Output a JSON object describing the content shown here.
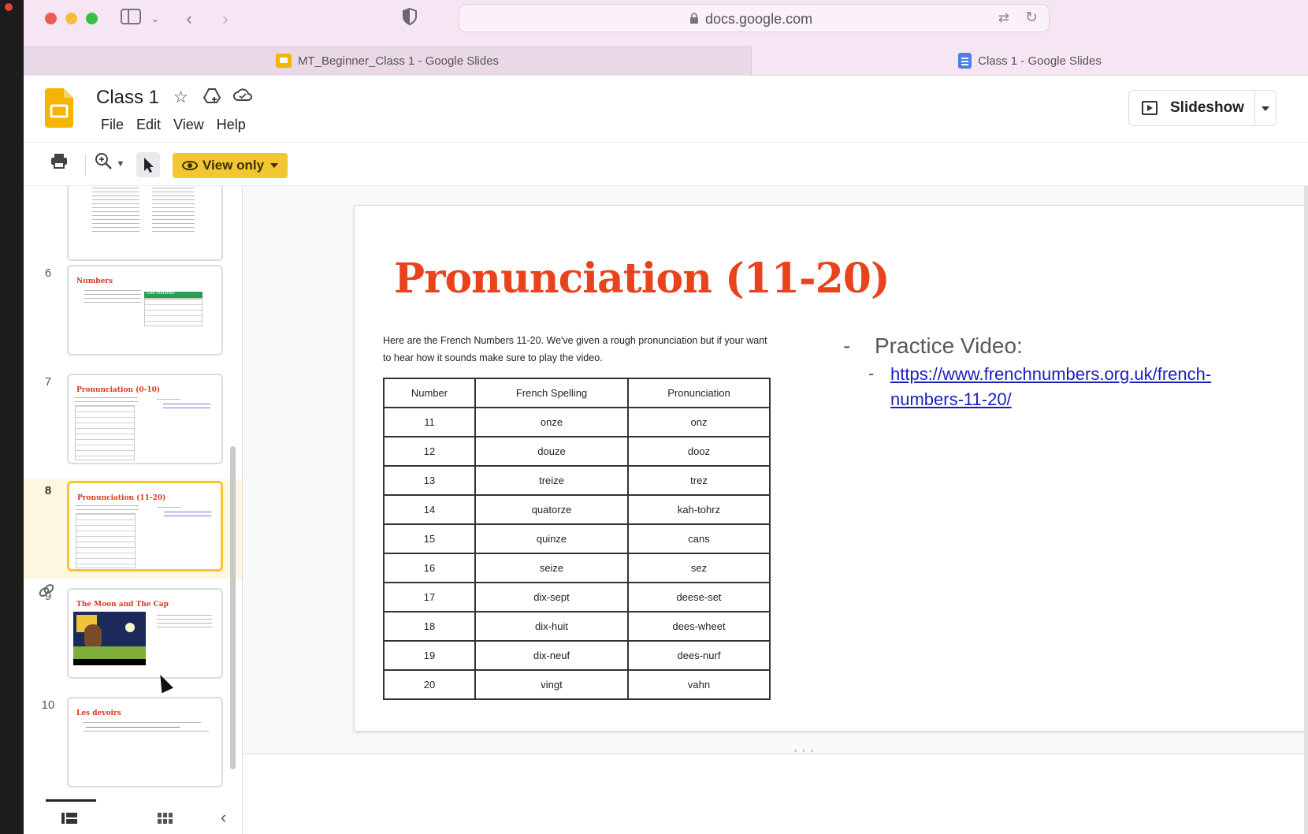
{
  "browser": {
    "url": "docs.google.com",
    "tabs": [
      {
        "label": "MT_Beginner_Class 1 - Google Slides",
        "icon": "slides-favicon"
      },
      {
        "label": "Class 1 - Google Slides",
        "icon": "docs-favicon"
      }
    ]
  },
  "app": {
    "title": "Class 1",
    "menu": [
      "File",
      "Edit",
      "View",
      "Help"
    ],
    "slideshow_label": "Slideshow",
    "view_only_label": "View only",
    "accent": "#f3c634"
  },
  "filmstrip": {
    "slides": [
      {
        "number": "",
        "title": ""
      },
      {
        "number": "6",
        "title": "Numbers",
        "table_title": "Les nombres"
      },
      {
        "number": "7",
        "title": "Pronunciation (0-10)"
      },
      {
        "number": "8",
        "title": "Pronunciation (11-20)",
        "selected": true
      },
      {
        "number": "9",
        "title": "The Moon and The Cap"
      },
      {
        "number": "10",
        "title": "Les devoirs"
      }
    ]
  },
  "slide": {
    "title": "Pronunciation (11-20)",
    "intro": "Here are the French Numbers 11-20. We've given a rough pronunciation but if your want to hear how it sounds make sure to play the video.",
    "table": {
      "headers": [
        "Number",
        "French Spelling",
        "Pronunciation"
      ],
      "rows": [
        [
          "11",
          "onze",
          "onz"
        ],
        [
          "12",
          "douze",
          "dooz"
        ],
        [
          "13",
          "treize",
          "trez"
        ],
        [
          "14",
          "quatorze",
          "kah-tohrz"
        ],
        [
          "15",
          "quinze",
          "cans"
        ],
        [
          "16",
          "seize",
          "sez"
        ],
        [
          "17",
          "dix-sept",
          "deese-set"
        ],
        [
          "18",
          "dix-huit",
          "dees-wheet"
        ],
        [
          "19",
          "dix-neuf",
          "dees-nurf"
        ],
        [
          "20",
          "vingt",
          "vahn"
        ]
      ]
    },
    "practice_label": "Practice Video:",
    "practice_link": "https://www.frenchnumbers.org.uk/french-numbers-11-20/",
    "title_color": "#e8431d",
    "link_color": "#1b1fb8"
  }
}
